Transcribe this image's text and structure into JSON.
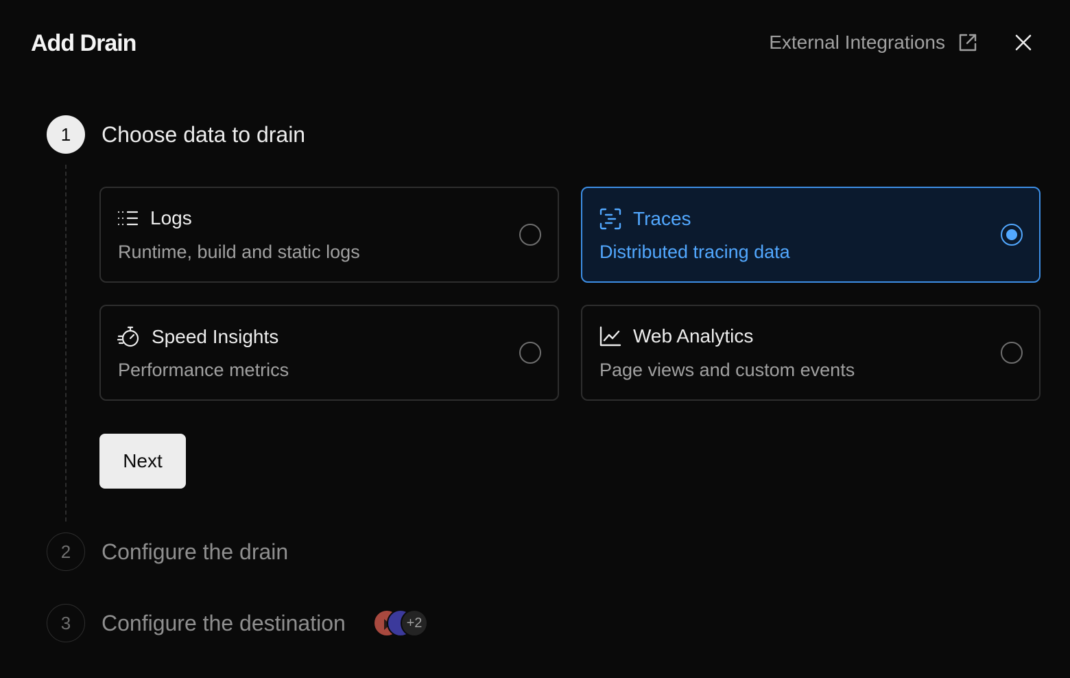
{
  "dialog": {
    "title": "Add Drain",
    "external_link": "External Integrations",
    "close_label": "Close"
  },
  "steps": [
    {
      "number": "1",
      "title": "Choose data to drain",
      "state": "active"
    },
    {
      "number": "2",
      "title": "Configure the drain",
      "state": "inactive"
    },
    {
      "number": "3",
      "title": "Configure the destination",
      "state": "inactive"
    }
  ],
  "options": [
    {
      "title": "Logs",
      "description": "Runtime, build and static logs",
      "icon": "list-icon",
      "selected": false
    },
    {
      "title": "Traces",
      "description": "Distributed tracing data",
      "icon": "traces-icon",
      "selected": true
    },
    {
      "title": "Speed Insights",
      "description": "Performance metrics",
      "icon": "stopwatch-icon",
      "selected": false
    },
    {
      "title": "Web Analytics",
      "description": "Page views and custom events",
      "icon": "line-chart-icon",
      "selected": false
    }
  ],
  "next_button": "Next",
  "destination_avatars": {
    "extra_count": "+2",
    "colors": [
      "#a8493f",
      "#3c3a9c"
    ]
  },
  "colors": {
    "background": "#0a0a0a",
    "accent": "#52a8ff",
    "selected_border": "#3d8fe6",
    "selected_background": "#0b1a2e"
  }
}
